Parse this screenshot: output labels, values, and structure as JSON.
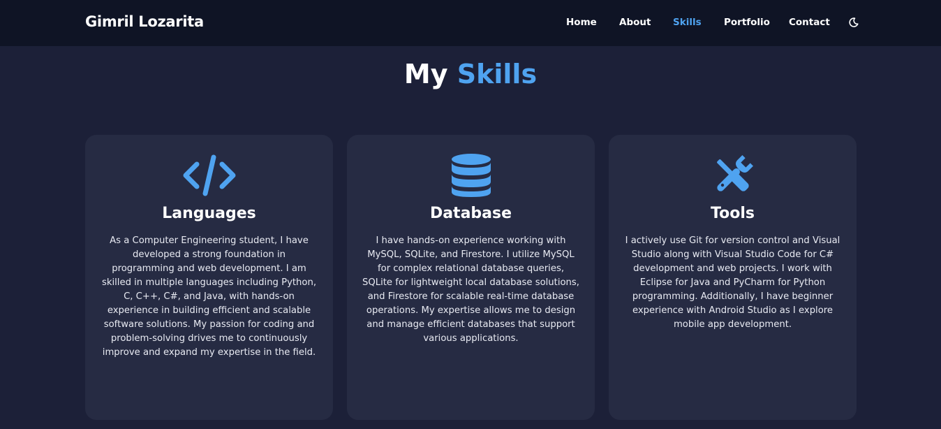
{
  "navbar": {
    "brand": "Gimril Lozarita",
    "links": [
      {
        "label": "Home",
        "active": false
      },
      {
        "label": "About",
        "active": false
      },
      {
        "label": "Skills",
        "active": true
      },
      {
        "label": "Portfolio",
        "active": false
      },
      {
        "label": "Contact",
        "active": false
      }
    ],
    "theme_toggle_icon": "moon-icon"
  },
  "section": {
    "title_plain": "My",
    "title_accent": "Skills"
  },
  "cards": [
    {
      "icon": "code-icon",
      "title": "Languages",
      "text": "As a Computer Engineering student, I have developed a strong foundation in programming and web development. I am skilled in multiple languages including Python, C, C++, C#, and Java, with hands-on experience in building efficient and scalable software solutions. My passion for coding and problem-solving drives me to continuously improve and expand my expertise in the field."
    },
    {
      "icon": "database-icon",
      "title": "Database",
      "text": "I have hands-on experience working with MySQL, SQLite, and Firestore. I utilize MySQL for complex relational database queries, SQLite for lightweight local database solutions, and Firestore for scalable real-time database operations. My expertise allows me to design and manage efficient databases that support various applications."
    },
    {
      "icon": "tools-icon",
      "title": "Tools",
      "text": "I actively use Git for version control and Visual Studio along with Visual Studio Code for C# development and web projects. I work with Eclipse for Java and PyCharm for Python programming. Additionally, I have beginner experience with Android Studio as I explore mobile app development."
    }
  ],
  "colors": {
    "page_bg": "#1c2038",
    "navbar_bg": "#0f1425",
    "card_bg": "#262b43",
    "accent": "#4fa3f0",
    "text": "#ffffff"
  }
}
